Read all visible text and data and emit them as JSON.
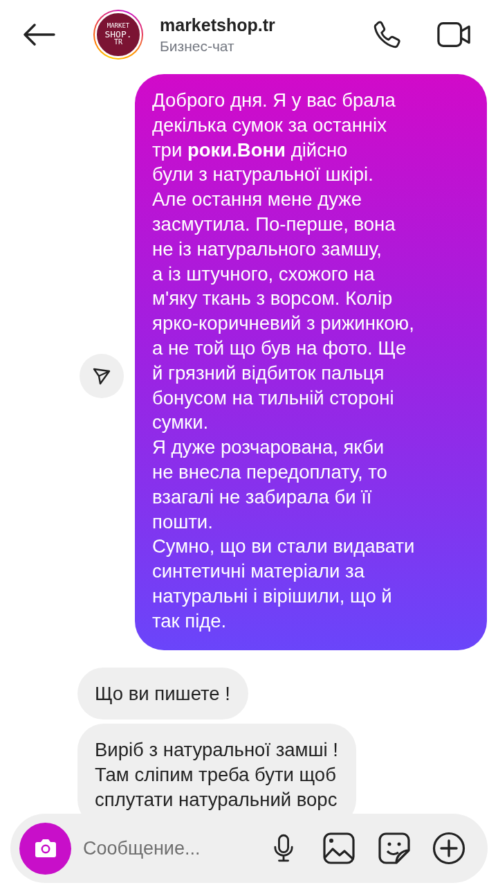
{
  "header": {
    "name": "marketshop.tr",
    "subtitle": "Бизнес-чат",
    "avatar_lines": [
      "MARKET",
      "SHOP.",
      "TR"
    ]
  },
  "messages": [
    {
      "kind": "sent",
      "text": "Доброго дня. Я у вас брала\nдекілька сумок за останніх\nтри **роки.Вони** дійсно\nбули з натуральної шкірі.\nАле остання мене дуже\nзасмутила. По-перше, вона\nне із натурального замшу,\nа із штучного, схожого на\nм'яку ткань з ворсом. Колір\nярко-коричневий з рижинкою,\nа не той що був на фото. Ще\nй грязний відбиток пальця\nбонусом на тильній стороні\nсумки.\nЯ дуже розчарована, якби\nне внесла передоплату, то\nвзагалі не забирала би її\nпошти.\nСумно, що ви стали видавати\nсинтетичні матеріали за\nнатуральні і вірішили, що й\nтак піде."
    },
    {
      "kind": "received",
      "text": "Що ви пишете !"
    },
    {
      "kind": "received",
      "text": "Виріб з натуральної замші !\nТам сліпим треба бути щоб\nсплутати натуральний ворс"
    }
  ],
  "composer": {
    "placeholder": "Сообщение..."
  }
}
